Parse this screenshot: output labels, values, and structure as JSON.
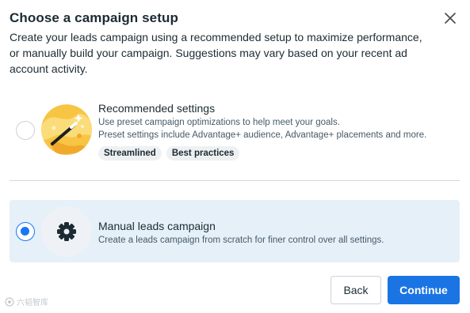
{
  "dialog": {
    "title": "Choose a campaign setup",
    "description": "Create your leads campaign using a recommended setup to maximize performance, or manually build your campaign. Suggestions may vary based on your recent ad account activity.",
    "close_icon": "close-icon"
  },
  "options": [
    {
      "title": "Recommended settings",
      "description_1": "Use preset campaign optimizations to help meet your goals.",
      "description_2": "Preset settings include Advantage+ audience, Advantage+ placements and more.",
      "tags": [
        "Streamlined",
        "Best practices"
      ],
      "icon": "magic-wand-icon",
      "selected": false
    },
    {
      "title": "Manual leads campaign",
      "description_1": "Create a leads campaign from scratch for finer control over all settings.",
      "icon": "gear-icon",
      "selected": true
    }
  ],
  "buttons": {
    "back": "Back",
    "continue": "Continue"
  },
  "watermark": "六韬智库",
  "colors": {
    "accent": "#1b74e4",
    "selected_bg": "#e6f0f9",
    "text": "#1c2b33"
  }
}
